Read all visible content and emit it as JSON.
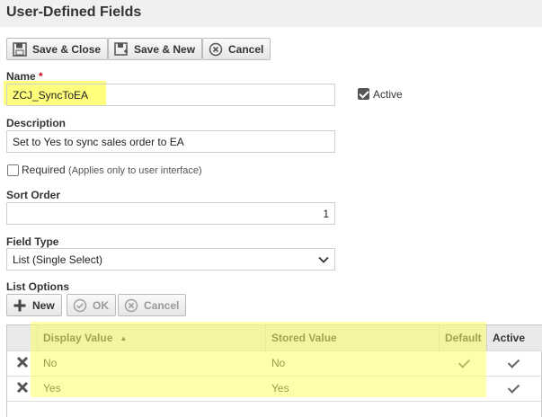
{
  "page": {
    "title": "User-Defined Fields"
  },
  "toolbar": {
    "save_close_label": "Save & Close",
    "save_new_label": "Save & New",
    "cancel_label": "Cancel"
  },
  "form": {
    "name": {
      "label": "Name",
      "required_mark": "*",
      "value": "ZCJ_SyncToEA"
    },
    "active": {
      "label": "Active",
      "checked": true
    },
    "description": {
      "label": "Description",
      "value": "Set to Yes to sync sales order to EA"
    },
    "required": {
      "label": "Required",
      "note": "(Applies only to user interface)",
      "checked": false
    },
    "sort_order": {
      "label": "Sort Order",
      "value": "1"
    },
    "field_type": {
      "label": "Field Type",
      "selected": "List (Single Select)"
    }
  },
  "list_options": {
    "label": "List Options",
    "new_label": "New",
    "ok_label": "OK",
    "cancel_label": "Cancel",
    "columns": {
      "display_value": "Display Value",
      "stored_value": "Stored Value",
      "default": "Default",
      "active": "Active"
    },
    "sort_indicator": "▲",
    "rows": [
      {
        "display": "No",
        "stored": "No",
        "default": true,
        "active": true
      },
      {
        "display": "Yes",
        "stored": "Yes",
        "default": false,
        "active": true
      }
    ]
  },
  "colors": {
    "highlight": "#ffff66",
    "required": "#d0021b",
    "header_bg": "#e9e9e9"
  }
}
